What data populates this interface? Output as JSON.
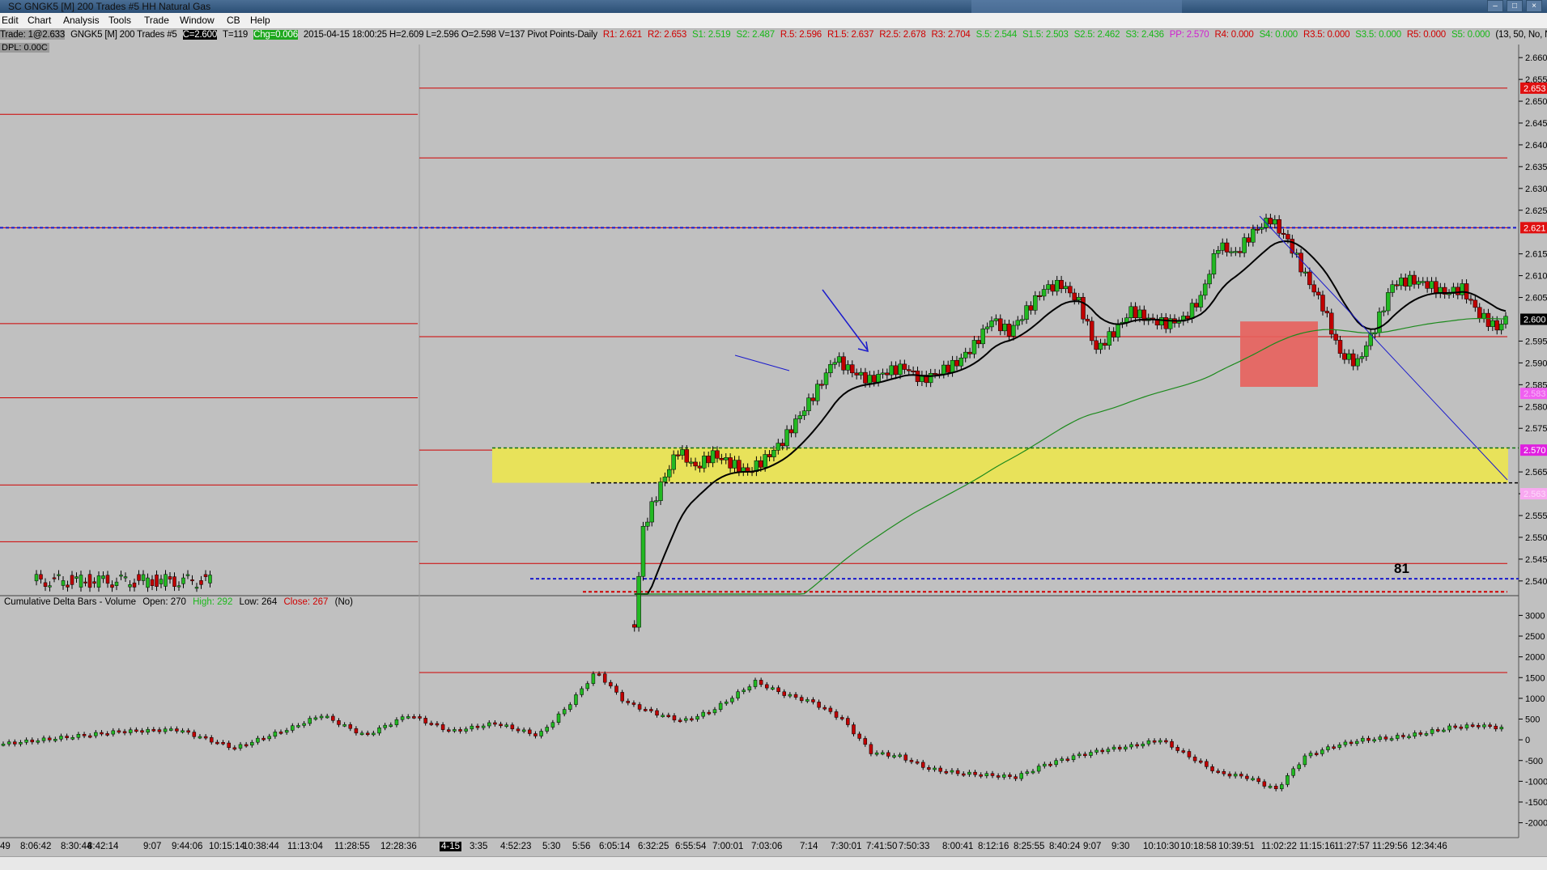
{
  "window": {
    "title": "SC GNGK5 [M]  200 Trades  #5  HH Natural Gas"
  },
  "menu": [
    "Edit",
    "Chart",
    "Analysis",
    "Tools",
    "Trade",
    "Window",
    "CB",
    "Help"
  ],
  "info": {
    "trade": "Trade: 1@2.633",
    "symbol": "GNGK5 [M]  200 Trades  #5",
    "close": "C=2.600",
    "trades": "T=119",
    "chg": "Chg=0.006",
    "ohlc": "2015-04-15 18:00:25 H=2.609 L=2.596 O=2.598 V=137 Pivot Points-Daily",
    "r1": "R1: 2.621",
    "r2": "R2: 2.653",
    "s1": "S1: 2.519",
    "s2": "S2: 2.487",
    "r05": "R.5: 2.596",
    "r15": "R1.5: 2.637",
    "r25": "R2.5: 2.678",
    "r3": "R3: 2.704",
    "s05": "S.5: 2.544",
    "s15": "S1.5: 2.503",
    "s25": "S2.5: 2.462",
    "s3": "S3: 2.436",
    "pp": "PP: 2.570",
    "r4": "R4: 0.000",
    "s4": "S4: 0.000",
    "r35": "R3.5: 0.000",
    "s35": "S3.5: 0.000",
    "r5": "R5: 0.000",
    "s5": "S5: 0.000",
    "params": "(13, 50, No, No"
  },
  "dpl": "DPL: 0.00C",
  "lower_panel": {
    "title": "Cumulative Delta Bars - Volume",
    "open": "Open: 270",
    "high": "High: 292",
    "low": "Low: 264",
    "close": "Close: 267",
    "flag": "(No)"
  },
  "annotation_81": "81",
  "x_labels": [
    "49",
    "8:06:42",
    "8:30:44",
    "8:42:14",
    "9:07",
    "9:44:06",
    "10:15:14",
    "10:38:44",
    "11:13:04",
    "11:28:55",
    "12:28:36",
    "4-15",
    "3:35",
    "4:52:23",
    "5:30",
    "5:56",
    "6:05:14",
    "6:32:25",
    "6:55:54",
    "7:00:01",
    "7:03:06",
    "7:14",
    "7:30:01",
    "7:41:50",
    "7:50:33",
    "8:00:41",
    "8:12:16",
    "8:25:55",
    "8:40:24",
    "9:07",
    "9:30",
    "10:10:30",
    "10:18:58",
    "10:39:51",
    "11:02:22",
    "11:15:16",
    "11:27:57",
    "11:29:56",
    "12:34:46"
  ],
  "price_axis_labels": [
    "2.660",
    "2.655",
    "2.650",
    "2.645",
    "2.640",
    "2.635",
    "2.630",
    "2.625",
    "2.615",
    "2.610",
    "2.605",
    "2.595",
    "2.590",
    "2.585",
    "2.580",
    "2.575",
    "2.565",
    "2.560",
    "2.555",
    "2.550",
    "2.545",
    "2.540"
  ],
  "price_axis_markers": {
    "r2": "2.653",
    "r1": "2.621",
    "current": "2.600",
    "pp": "2.570",
    "pink_hi": "2.583",
    "pink_lo": "2.563"
  },
  "delta_axis_labels": [
    "3000",
    "2500",
    "2000",
    "1500",
    "1000",
    "500",
    "0",
    "-500",
    "-1000",
    "-1500",
    "-2000"
  ],
  "colors": {
    "background": "#c0c0c0",
    "up_candle": "#22b822",
    "down_candle": "#c00000",
    "pivot_line": "#d00000",
    "zone": "#e8e25a",
    "box": "#e8605c"
  },
  "chart_data": [
    {
      "type": "candlestick",
      "title": "GNGK5 [M] 200 Trades #5 HH Natural Gas",
      "ylim": [
        2.537,
        2.663
      ],
      "pivot_levels": {
        "R2": 2.653,
        "R1.5": 2.637,
        "R1": 2.621,
        "R.5": 2.596,
        "PP": 2.57,
        "S.5": 2.544,
        "S1": 2.519
      },
      "close_path": [
        [
          0,
          2.54
        ],
        [
          6,
          2.542
        ],
        [
          10,
          2.541
        ],
        [
          14,
          2.54
        ],
        [
          16,
          2.536
        ],
        [
          18,
          2.53
        ],
        [
          19,
          2.552
        ],
        [
          21,
          2.562
        ],
        [
          23,
          2.57
        ],
        [
          25,
          2.566
        ],
        [
          27,
          2.569
        ],
        [
          29,
          2.567
        ],
        [
          31,
          2.565
        ],
        [
          33,
          2.568
        ],
        [
          35,
          2.572
        ],
        [
          37,
          2.578
        ],
        [
          39,
          2.584
        ],
        [
          41,
          2.591
        ],
        [
          43,
          2.588
        ],
        [
          45,
          2.586
        ],
        [
          47,
          2.588
        ],
        [
          49,
          2.589
        ],
        [
          51,
          2.586
        ],
        [
          53,
          2.588
        ],
        [
          55,
          2.59
        ],
        [
          57,
          2.594
        ],
        [
          59,
          2.6
        ],
        [
          61,
          2.597
        ],
        [
          63,
          2.602
        ],
        [
          65,
          2.607
        ],
        [
          67,
          2.608
        ],
        [
          69,
          2.604
        ],
        [
          71,
          2.593
        ],
        [
          73,
          2.597
        ],
        [
          75,
          2.602
        ],
        [
          77,
          2.6
        ],
        [
          79,
          2.599
        ],
        [
          81,
          2.6
        ],
        [
          83,
          2.605
        ],
        [
          85,
          2.617
        ],
        [
          87,
          2.615
        ],
        [
          89,
          2.62
        ],
        [
          91,
          2.623
        ],
        [
          93,
          2.618
        ],
        [
          95,
          2.61
        ],
        [
          97,
          2.603
        ],
        [
          99,
          2.592
        ],
        [
          101,
          2.59
        ],
        [
          103,
          2.598
        ],
        [
          105,
          2.608
        ],
        [
          107,
          2.609
        ],
        [
          109,
          2.608
        ],
        [
          111,
          2.606
        ],
        [
          113,
          2.607
        ],
        [
          115,
          2.601
        ],
        [
          117,
          2.598
        ],
        [
          118,
          2.6
        ]
      ],
      "series": [
        {
          "name": "",
          "role": "ema-13",
          "color": "#000000"
        },
        {
          "name": "",
          "role": "ema-50",
          "color": "#1c8a1c"
        }
      ]
    },
    {
      "type": "bar",
      "title": "Cumulative Delta Bars - Volume",
      "ylim": [
        -2300,
        3300
      ],
      "values": [
        [
          0,
          -100
        ],
        [
          4,
          50
        ],
        [
          8,
          200
        ],
        [
          12,
          250
        ],
        [
          16,
          -200
        ],
        [
          20,
          300
        ],
        [
          22,
          600
        ],
        [
          25,
          100
        ],
        [
          28,
          600
        ],
        [
          31,
          200
        ],
        [
          34,
          400
        ],
        [
          37,
          100
        ],
        [
          39,
          800
        ],
        [
          41,
          1650
        ],
        [
          43,
          900
        ],
        [
          45,
          650
        ],
        [
          47,
          450
        ],
        [
          49,
          700
        ],
        [
          52,
          1400
        ],
        [
          54,
          1100
        ],
        [
          56,
          900
        ],
        [
          58,
          500
        ],
        [
          60,
          -300
        ],
        [
          62,
          -400
        ],
        [
          64,
          -700
        ],
        [
          66,
          -800
        ],
        [
          68,
          -850
        ],
        [
          70,
          -900
        ],
        [
          72,
          -600
        ],
        [
          74,
          -400
        ],
        [
          76,
          -250
        ],
        [
          78,
          -150
        ],
        [
          80,
          0
        ],
        [
          82,
          -400
        ],
        [
          84,
          -800
        ],
        [
          86,
          -900
        ],
        [
          88,
          -1200
        ],
        [
          90,
          -400
        ],
        [
          92,
          -150
        ],
        [
          94,
          0
        ],
        [
          96,
          50
        ],
        [
          98,
          150
        ],
        [
          100,
          300
        ],
        [
          102,
          350
        ],
        [
          104,
          267
        ]
      ]
    }
  ]
}
